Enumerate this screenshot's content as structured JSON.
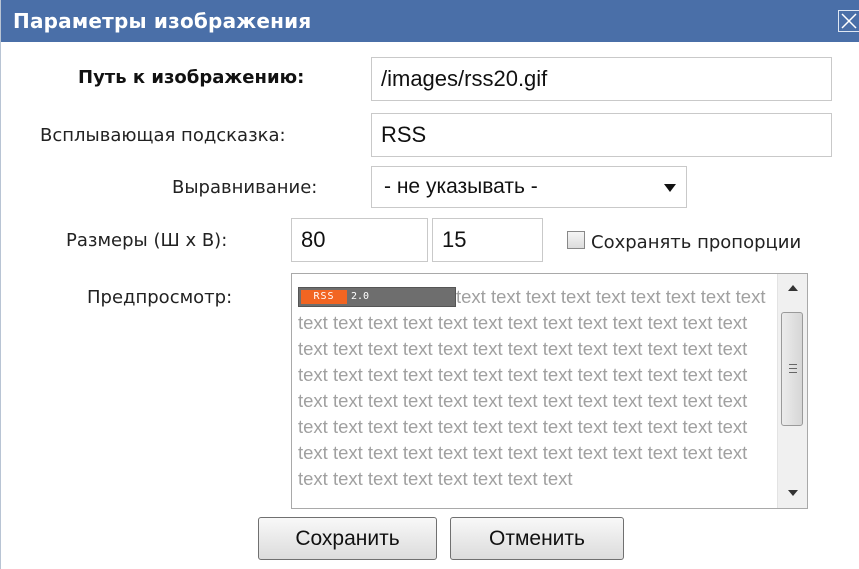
{
  "dialog": {
    "title": "Параметры изображения"
  },
  "fields": {
    "path_label": "Путь к изображению:",
    "path_value": "/images/rss20.gif",
    "tooltip_label": "Всплывающая подсказка:",
    "tooltip_value": "RSS",
    "align_label": "Выравнивание:",
    "align_selected": "- не указывать -",
    "size_label": "Размеры (Ш x В):",
    "width_value": "80",
    "times_sign": "x",
    "height_value": "15",
    "keep_proportions_label": "Сохранять пропорции",
    "keep_proportions_checked": false
  },
  "preview": {
    "label": "Предпросмотр:",
    "image_badge_left": "RSS",
    "image_badge_right": "2.0",
    "filler_text": "text text text text text text text text text text text text text text text text text text text text text text text text text text text text text text text text text text text text text text text text text text text text text text text text text text text text text text text text text text text text text text text text text text text text text text text text text text text text text text text text text text text text text text text text text text text text text text text"
  },
  "buttons": {
    "save_label": "Сохранить",
    "cancel_label": "Отменить"
  },
  "colors": {
    "titlebar": "#4a6fa8",
    "preview_text": "#a0a0a0",
    "rss_orange": "#f26522"
  }
}
